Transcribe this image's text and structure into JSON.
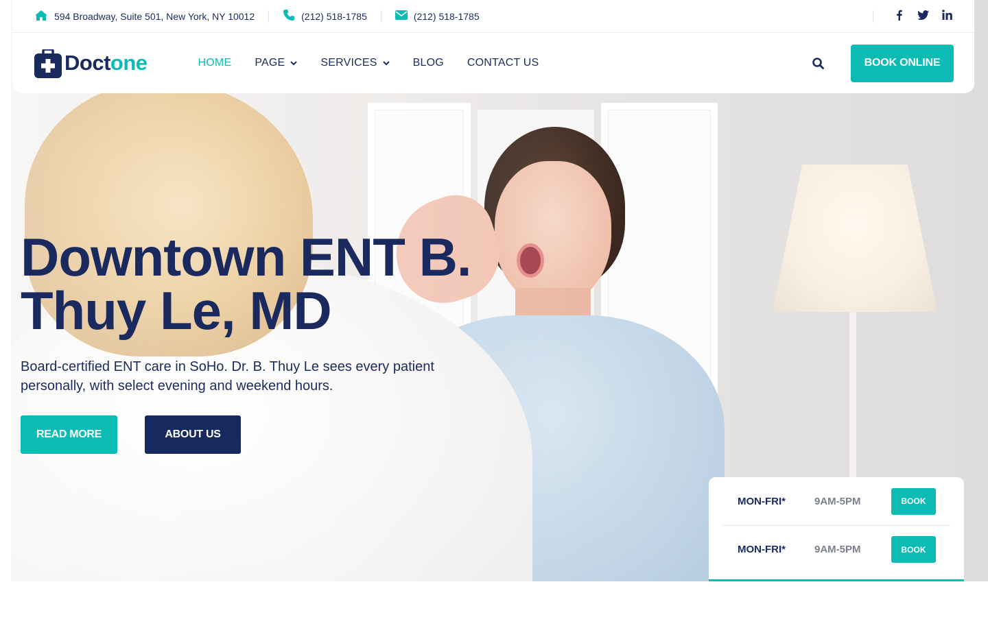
{
  "topbar": {
    "address": "594 Broadway, Suite 501, New York, NY 10012",
    "phone": "(212) 518-1785",
    "email": "(212) 518-1785",
    "icons": {
      "address": "home-icon",
      "phone": "phone-icon",
      "email": "envelope-icon"
    },
    "social": [
      {
        "name": "facebook-icon",
        "glyph": "f"
      },
      {
        "name": "twitter-icon",
        "glyph": "🐦"
      },
      {
        "name": "linkedin-icon",
        "glyph": "in"
      }
    ]
  },
  "header": {
    "logo": {
      "part1": "Doct",
      "part2": "one",
      "icon": "medical-kit-icon"
    },
    "nav": [
      {
        "label": "HOME",
        "active": true,
        "dropdown": false
      },
      {
        "label": "PAGE",
        "active": false,
        "dropdown": true
      },
      {
        "label": "SERVICES",
        "active": false,
        "dropdown": true
      },
      {
        "label": "BLOG",
        "active": false,
        "dropdown": false
      },
      {
        "label": "CONTACT US",
        "active": false,
        "dropdown": false
      }
    ],
    "search_icon": "search-icon",
    "book_label": "BOOK ONLINE"
  },
  "hero": {
    "title_line1": "Downtown ENT B.",
    "title_line2": "Thuy Le, MD",
    "subtitle": "Board-certified ENT care in SoHo. Dr. B. Thuy Le sees every patient personally, with select evening and weekend hours.",
    "read_more": "READ MORE",
    "about_us": "ABOUT US"
  },
  "hours": [
    {
      "day": "MON-FRI*",
      "time": "9AM-5PM",
      "book": "BOOK"
    },
    {
      "day": "MON-FRI*",
      "time": "9AM-5PM",
      "book": "BOOK"
    }
  ],
  "colors": {
    "accent": "#0cbbb3",
    "navy": "#1a2a5e",
    "button_navy": "#172a5f",
    "muted": "#7a7f8c"
  }
}
